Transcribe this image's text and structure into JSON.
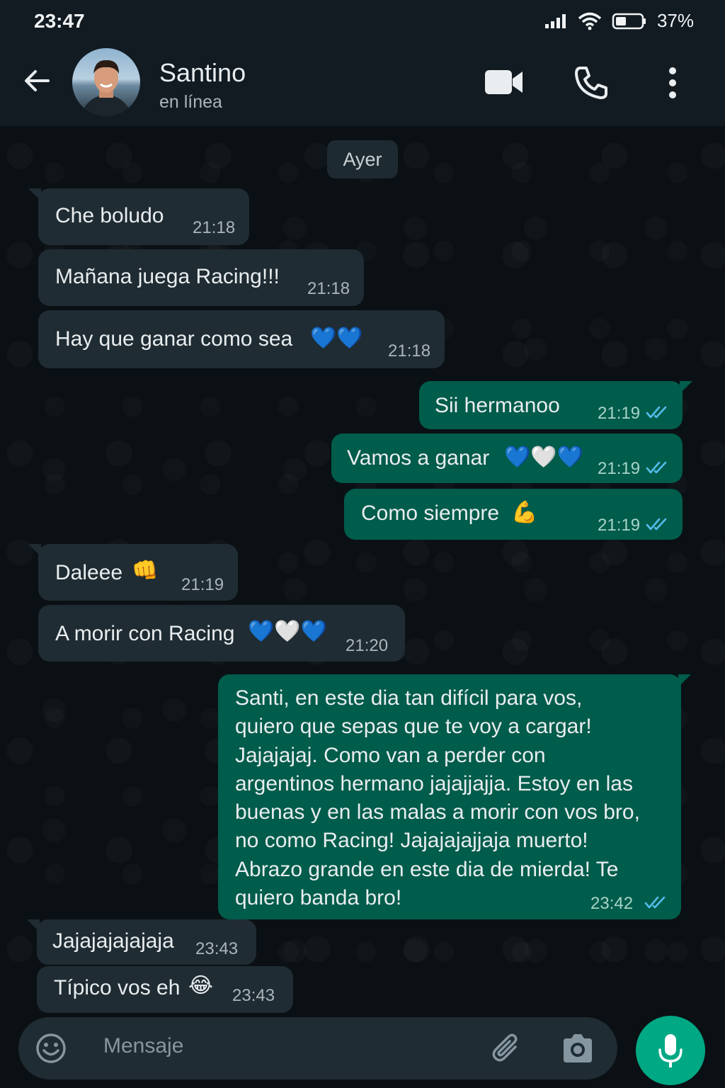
{
  "status_bar": {
    "time": "23:47",
    "battery": "37%"
  },
  "header": {
    "contact_name": "Santino",
    "contact_status": "en línea"
  },
  "day_separator": "Ayer",
  "messages": [
    {
      "text": "Che boludo",
      "time": "21:18",
      "direction": "in"
    },
    {
      "text": "Mañana juega Racing!!!",
      "time": "21:18",
      "direction": "in"
    },
    {
      "text": "Hay que ganar como sea",
      "emoji": "💙💙",
      "time": "21:18",
      "direction": "in"
    },
    {
      "text": "Sii hermanoo",
      "time": "21:19",
      "direction": "out",
      "status": "read"
    },
    {
      "text": "Vamos a ganar",
      "emoji": "💙🤍💙",
      "time": "21:19",
      "direction": "out",
      "status": "read"
    },
    {
      "text": "Como siempre",
      "emoji": "💪",
      "time": "21:19",
      "direction": "out",
      "status": "read"
    },
    {
      "text": "Daleee",
      "emoji": "👊",
      "time": "21:19",
      "direction": "in"
    },
    {
      "text": "A morir con Racing",
      "emoji": "💙🤍💙",
      "time": "21:20",
      "direction": "in"
    },
    {
      "text": "Santi, en este dia tan difícil para vos, quiero que sepas que te voy a cargar! Jajajajaj. Como van a perder con argentinos hermano jajajjajja. Estoy en las buenas y en las malas a morir con vos bro, no como Racing! Jajajajajjaja muerto! Abrazo grande en este dia de mierda! Te quiero banda bro!",
      "time": "23:42",
      "direction": "out",
      "status": "read"
    },
    {
      "text": "Jajajajajajaja",
      "time": "23:43",
      "direction": "in"
    },
    {
      "text": "Típico vos eh",
      "emoji": "😂",
      "time": "23:43",
      "direction": "in"
    }
  ],
  "composer": {
    "placeholder": "Mensaje"
  },
  "icons": [
    "back-arrow-icon",
    "video-call-icon",
    "phone-icon",
    "more-vert-icon",
    "emoji-icon",
    "attach-icon",
    "camera-icon",
    "mic-icon",
    "double-check-icon"
  ],
  "colors": {
    "incoming_bubble": "#1f2c33",
    "outgoing_bubble": "#005c4b",
    "accent": "#00a884",
    "read_ticks": "#53bdeb"
  }
}
